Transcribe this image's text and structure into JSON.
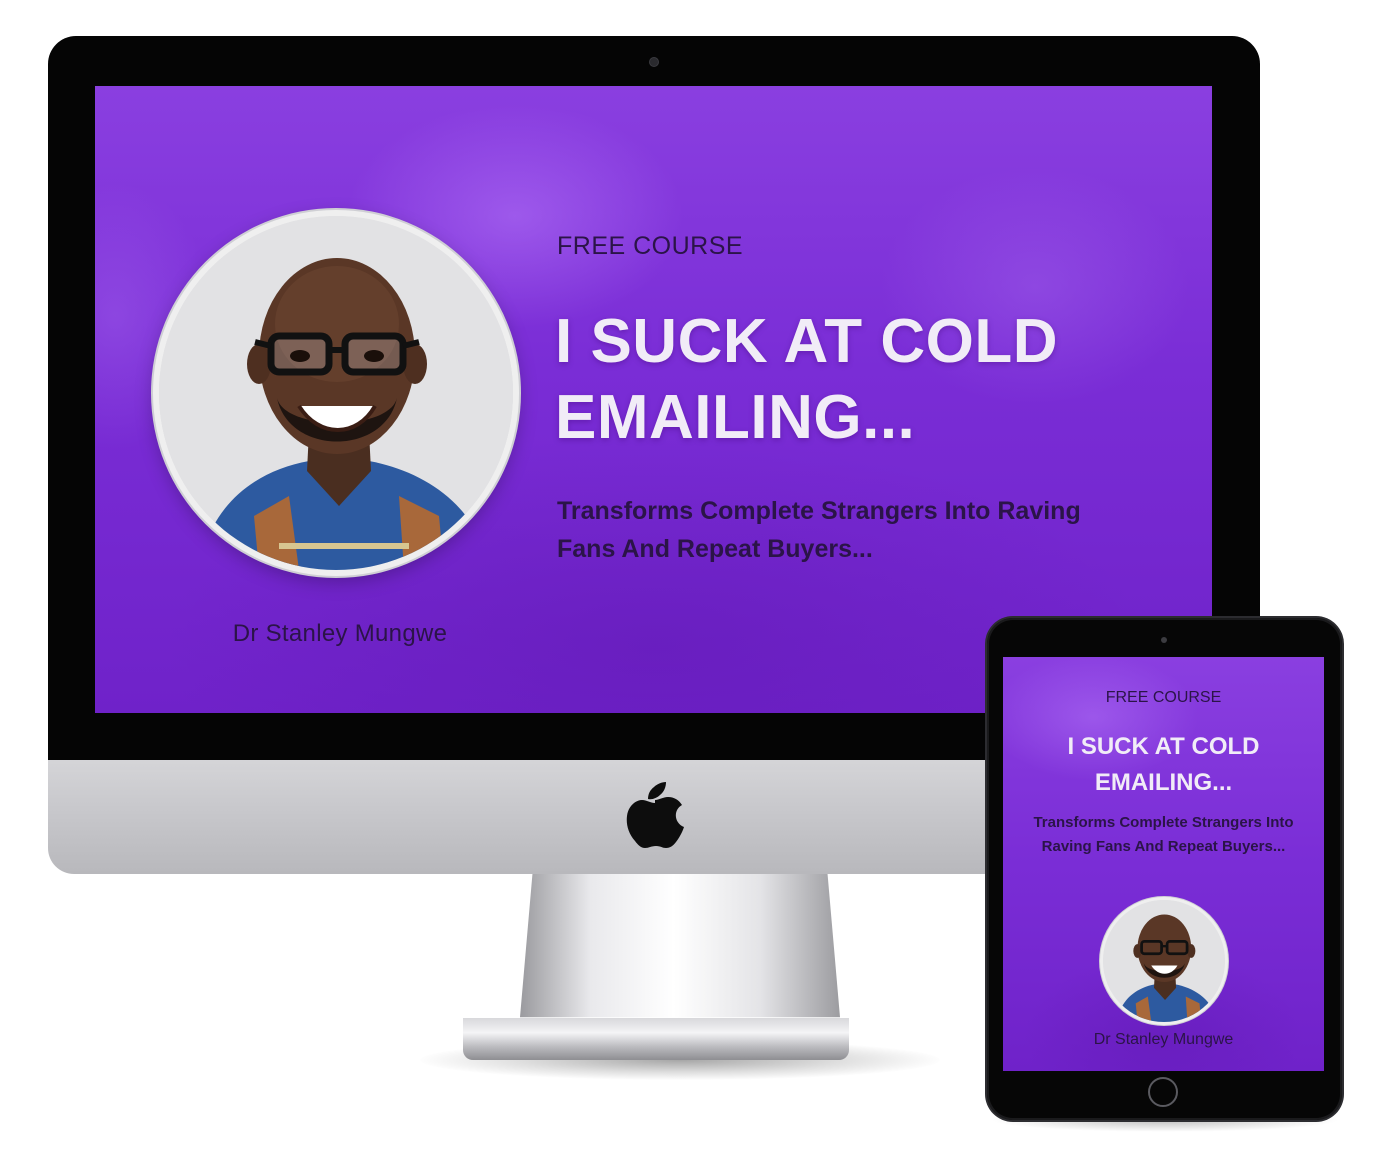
{
  "course": {
    "eyebrow": "FREE COURSE",
    "headline": "I SUCK AT COLD EMAILING...",
    "subhead": "Transforms Complete Strangers Into Raving Fans And Repeat Buyers...",
    "author": "Dr Stanley Mungwe"
  },
  "colors": {
    "primary_purple": "#7a2dd6",
    "dark_text": "#2b1448",
    "headline_text": "#f1ecf7"
  },
  "icons": {
    "brand_logo": "apple-logo-icon"
  }
}
